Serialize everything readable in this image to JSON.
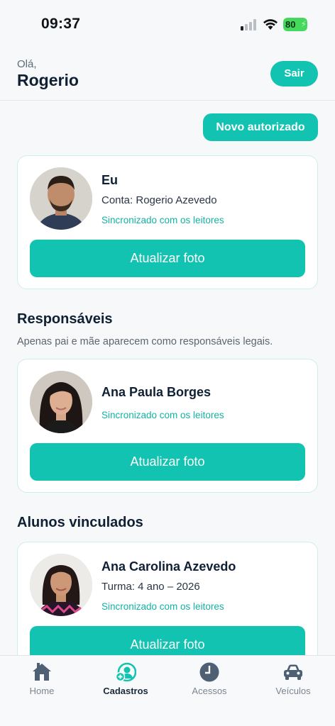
{
  "status_bar": {
    "time": "09:37",
    "battery": "80"
  },
  "header": {
    "greeting": "Olá,",
    "user_name": "Rogerio",
    "logout_label": "Sair"
  },
  "new_authorized_label": "Novo autorizado",
  "self_card": {
    "name": "Eu",
    "account": "Conta: Rogerio Azevedo",
    "sync_status": "Sincronizado com os leitores",
    "button_label": "Atualizar foto"
  },
  "guardians": {
    "title": "Responsáveis",
    "subtitle": "Apenas pai e mãe aparecem como responsáveis legais.",
    "items": [
      {
        "name": "Ana Paula Borges",
        "sync_status": "Sincronizado com os leitores",
        "button_label": "Atualizar foto"
      }
    ]
  },
  "students": {
    "title": "Alunos vinculados",
    "items": [
      {
        "name": "Ana Carolina Azevedo",
        "class": "Turma: 4 ano – 2026",
        "sync_status": "Sincronizado com os leitores",
        "button_label": "Atualizar foto"
      }
    ]
  },
  "tabbar": {
    "items": [
      {
        "label": "Home",
        "icon": "home-icon",
        "active": false
      },
      {
        "label": "Cadastros",
        "icon": "user-add-icon",
        "active": true
      },
      {
        "label": "Acessos",
        "icon": "clock-icon",
        "active": false
      },
      {
        "label": "Veículos",
        "icon": "car-icon",
        "active": false
      }
    ]
  },
  "colors": {
    "accent": "#12c3b1",
    "text": "#0f2035",
    "sync_text": "#12b3a3",
    "card_border": "#cdeee9"
  }
}
